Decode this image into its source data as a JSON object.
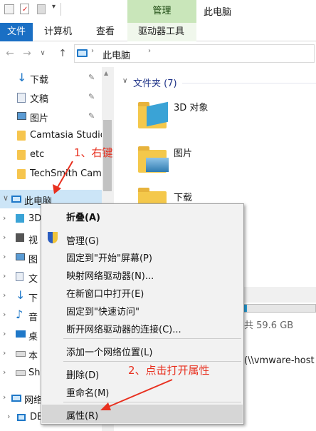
{
  "window": {
    "title": "此电脑",
    "contextual_tab": "管理"
  },
  "ribbon": {
    "file_tab": "文件",
    "tabs": [
      "计算机",
      "查看",
      "驱动器工具"
    ]
  },
  "address": {
    "path": "此电脑"
  },
  "nav_pane": {
    "quick_access": [
      {
        "label": "下载",
        "pinned": true,
        "icon": "download-arrow-icon"
      },
      {
        "label": "文稿",
        "pinned": true,
        "icon": "documents-icon"
      },
      {
        "label": "图片",
        "pinned": true,
        "icon": "pictures-icon"
      },
      {
        "label": "Camtasia Studio",
        "pinned": false,
        "icon": "folder-icon"
      },
      {
        "label": "etc",
        "pinned": false,
        "icon": "folder-icon"
      },
      {
        "label": "TechSmith Cam",
        "pinned": false,
        "icon": "folder-icon"
      }
    ],
    "this_pc": "此电脑",
    "pc_children": [
      "3D",
      "视",
      "图",
      "文",
      "下",
      "音",
      "桌",
      "本",
      "Sh"
    ],
    "network": "网络",
    "network_child": "DE"
  },
  "content": {
    "group_header": "文件夹 (7)",
    "folders": [
      "3D 对象",
      "图片",
      "下载"
    ],
    "drive_free_text": "共 59.6 GB",
    "network_path": "(\\\\vmware-host"
  },
  "context_menu": {
    "items": [
      {
        "label": "折叠(A)",
        "bold": true
      },
      {
        "label": "管理(G)",
        "icon": "uac-shield-icon"
      },
      {
        "label": "固定到\"开始\"屏幕(P)"
      },
      {
        "label": "映射网络驱动器(N)..."
      },
      {
        "label": "在新窗口中打开(E)"
      },
      {
        "label": "固定到\"快速访问\""
      },
      {
        "label": "断开网络驱动器的连接(C)..."
      },
      {
        "label": "添加一个网络位置(L)"
      },
      {
        "label": "删除(D)"
      },
      {
        "label": "重命名(M)"
      },
      {
        "label": "属性(R)",
        "highlighted": true
      }
    ]
  },
  "annotations": {
    "step1": "1、右键",
    "step2": "2、点击打开属性",
    "color": "#e8301f"
  },
  "colors": {
    "accent": "#1a6fc4",
    "manage_tab": "#c9e6ba",
    "selection": "#cce5f7"
  }
}
